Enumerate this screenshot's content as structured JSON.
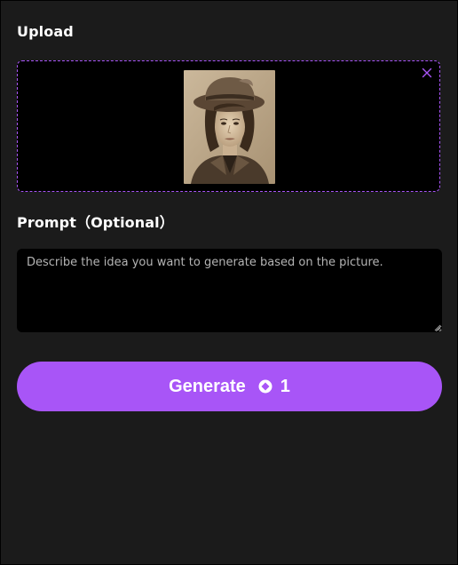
{
  "upload": {
    "label": "Upload",
    "image_alt": "Sepia portrait of a woman wearing a hat"
  },
  "prompt": {
    "label": "Prompt（Optional）",
    "value": "",
    "placeholder": "Describe the idea you want to generate based on the picture."
  },
  "generate": {
    "label": "Generate",
    "cost": "1"
  },
  "colors": {
    "accent": "#a855f7",
    "background": "#1b1b1b",
    "field_background": "#000000"
  },
  "icons": {
    "close": "close-icon",
    "credit": "credit-coin-icon"
  }
}
